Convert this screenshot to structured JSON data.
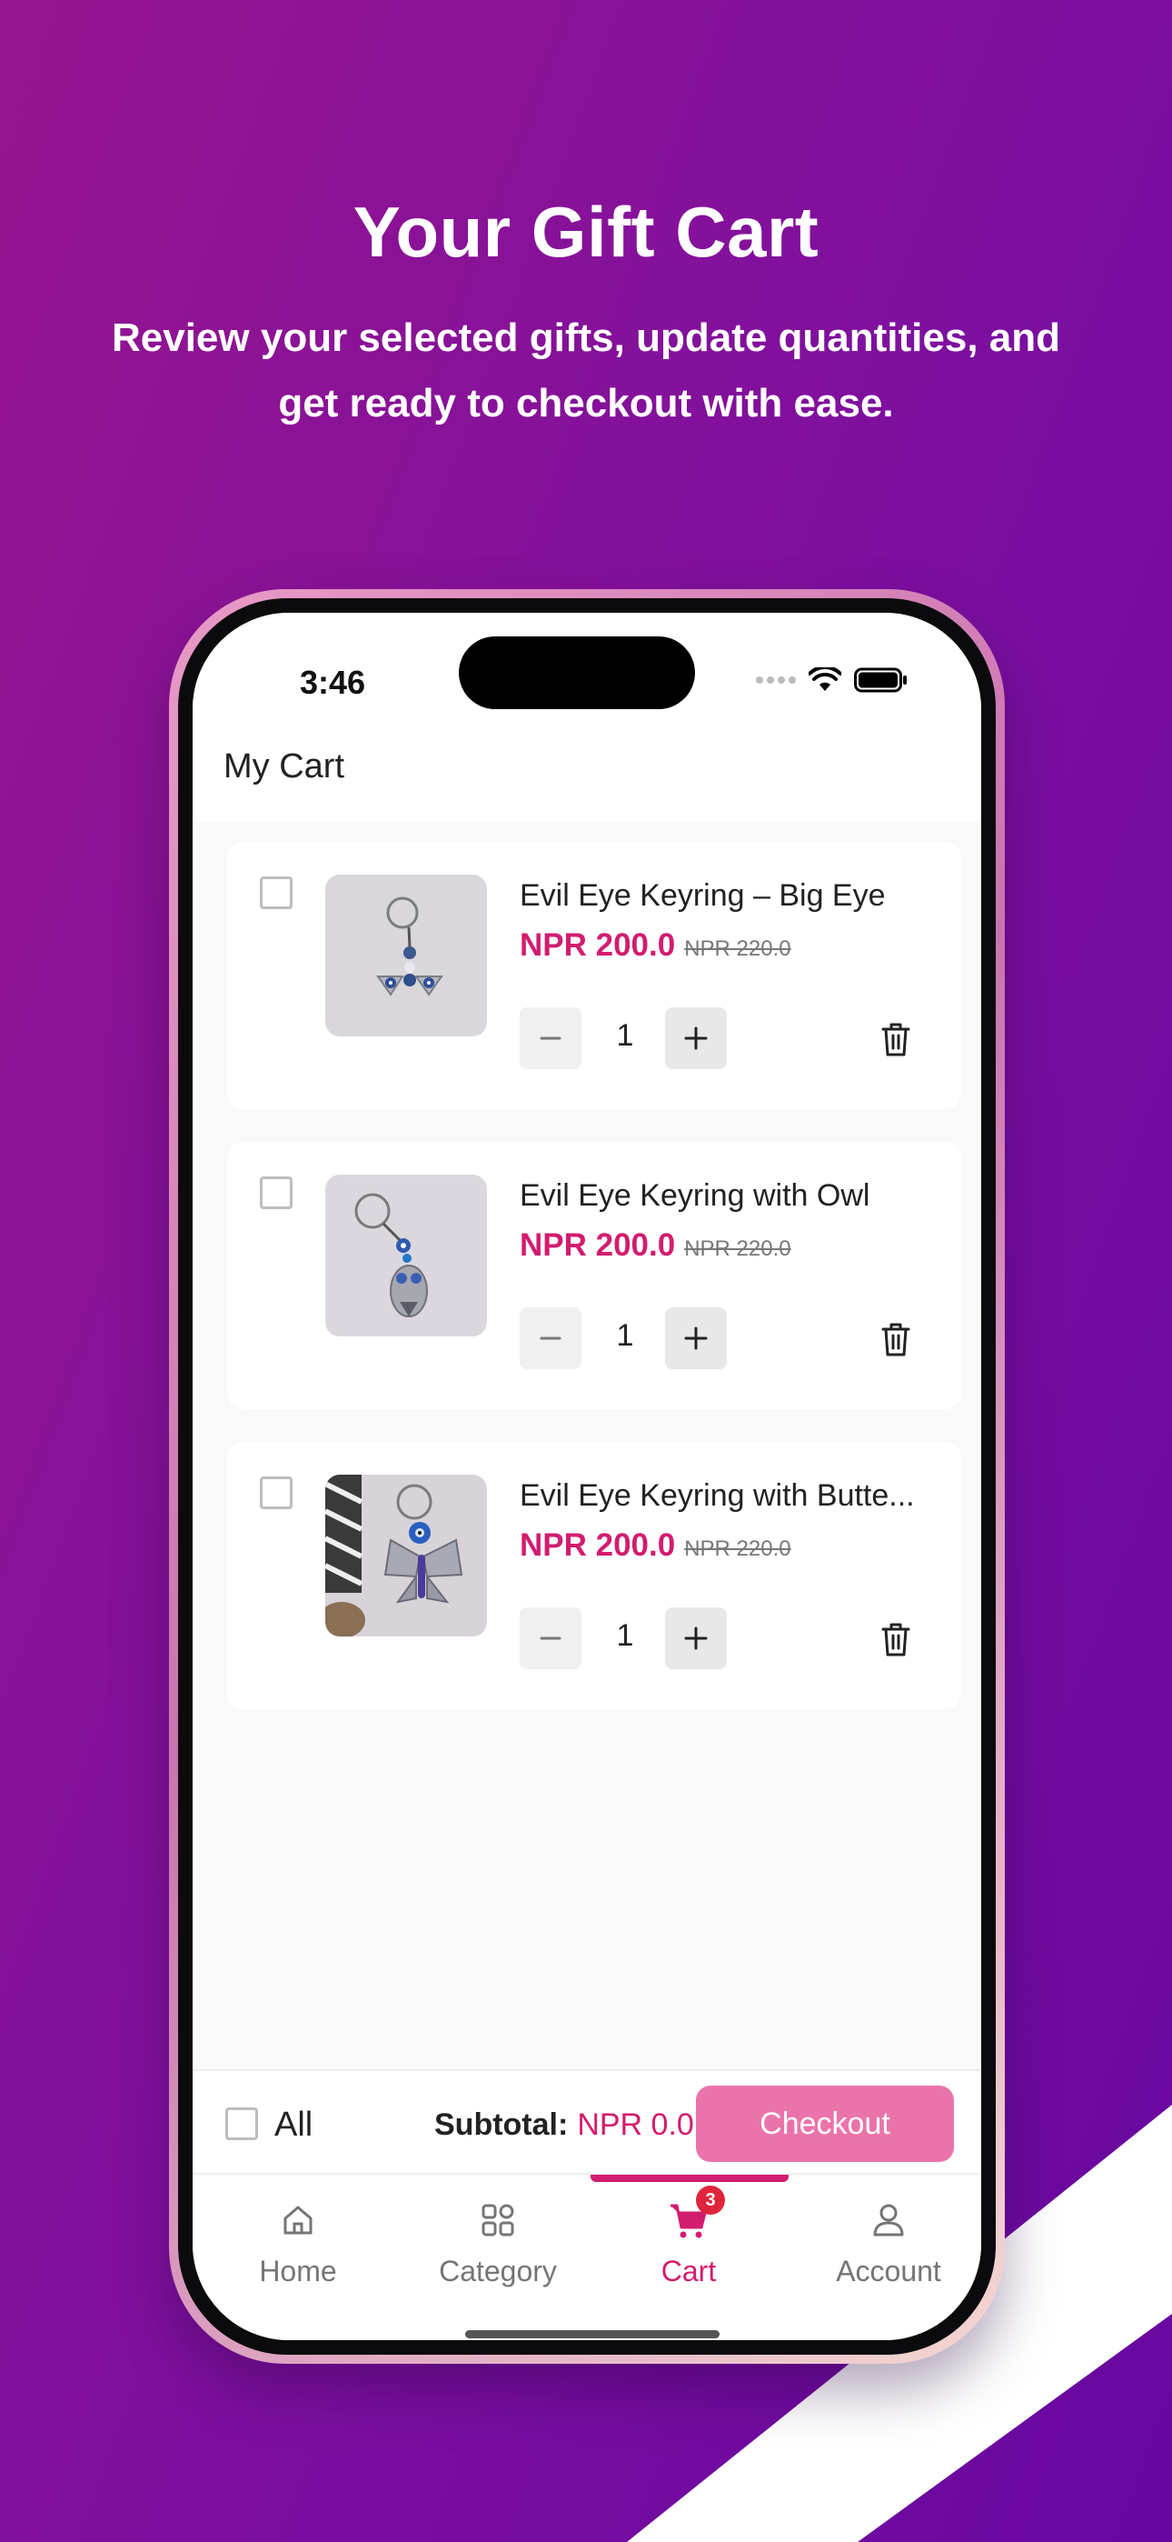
{
  "hero": {
    "title": "Your Gift Cart",
    "subtitle": "Review your selected gifts, update quantities, and get ready to checkout with ease."
  },
  "status_bar": {
    "time": "3:46",
    "icons": [
      "cellular-dots-icon",
      "wifi-icon",
      "battery-icon"
    ]
  },
  "header": {
    "title": "My Cart"
  },
  "cart": {
    "items": [
      {
        "name": "Evil Eye Keyring – Big Eye",
        "price": "NPR 200.0",
        "old_price": "NPR 220.0",
        "quantity": "1",
        "selected": false,
        "image": "keyring-big-eye-photo"
      },
      {
        "name": "Evil Eye Keyring with Owl",
        "price": "NPR 200.0",
        "old_price": "NPR 220.0",
        "quantity": "1",
        "selected": false,
        "image": "keyring-owl-photo"
      },
      {
        "name": "Evil Eye Keyring with Butte...",
        "price": "NPR 200.0",
        "old_price": "NPR 220.0",
        "quantity": "1",
        "selected": false,
        "image": "keyring-butterfly-photo"
      }
    ]
  },
  "footer": {
    "all_label": "All",
    "subtotal_label": "Subtotal:",
    "subtotal_value": "NPR 0.0",
    "checkout_label": "Checkout"
  },
  "tabs": [
    {
      "label": "Home",
      "icon": "home-icon",
      "active": false
    },
    {
      "label": "Category",
      "icon": "grid-icon",
      "active": false
    },
    {
      "label": "Cart",
      "icon": "cart-icon",
      "active": true,
      "badge": "3"
    },
    {
      "label": "Account",
      "icon": "user-icon",
      "active": false
    }
  ],
  "colors": {
    "accent": "#d21c6e",
    "checkout_button": "#ea74aa",
    "background_start": "#95158f",
    "background_end": "#66079f"
  }
}
